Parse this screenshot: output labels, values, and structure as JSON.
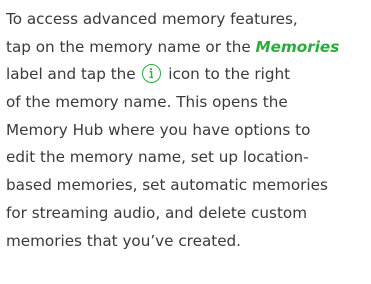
{
  "paragraph": {
    "line1": "To access advanced memory features,",
    "line2_before": "tap on the memory name or the ",
    "line2_emphasis": "Memories",
    "line3_before": "label and tap the ",
    "line3_icon": "info-icon",
    "line3_after": " icon to the right",
    "line4": "of the memory name. This opens the",
    "line5": "Memory Hub where you have options to",
    "line6": "edit the memory name, set up location-",
    "line7": "based memories, set automatic memories",
    "line8": "for streaming audio, and delete custom",
    "line9": "memories that you’ve created."
  },
  "colors": {
    "text": "#3a3a3a",
    "accent": "#2bab3c"
  }
}
